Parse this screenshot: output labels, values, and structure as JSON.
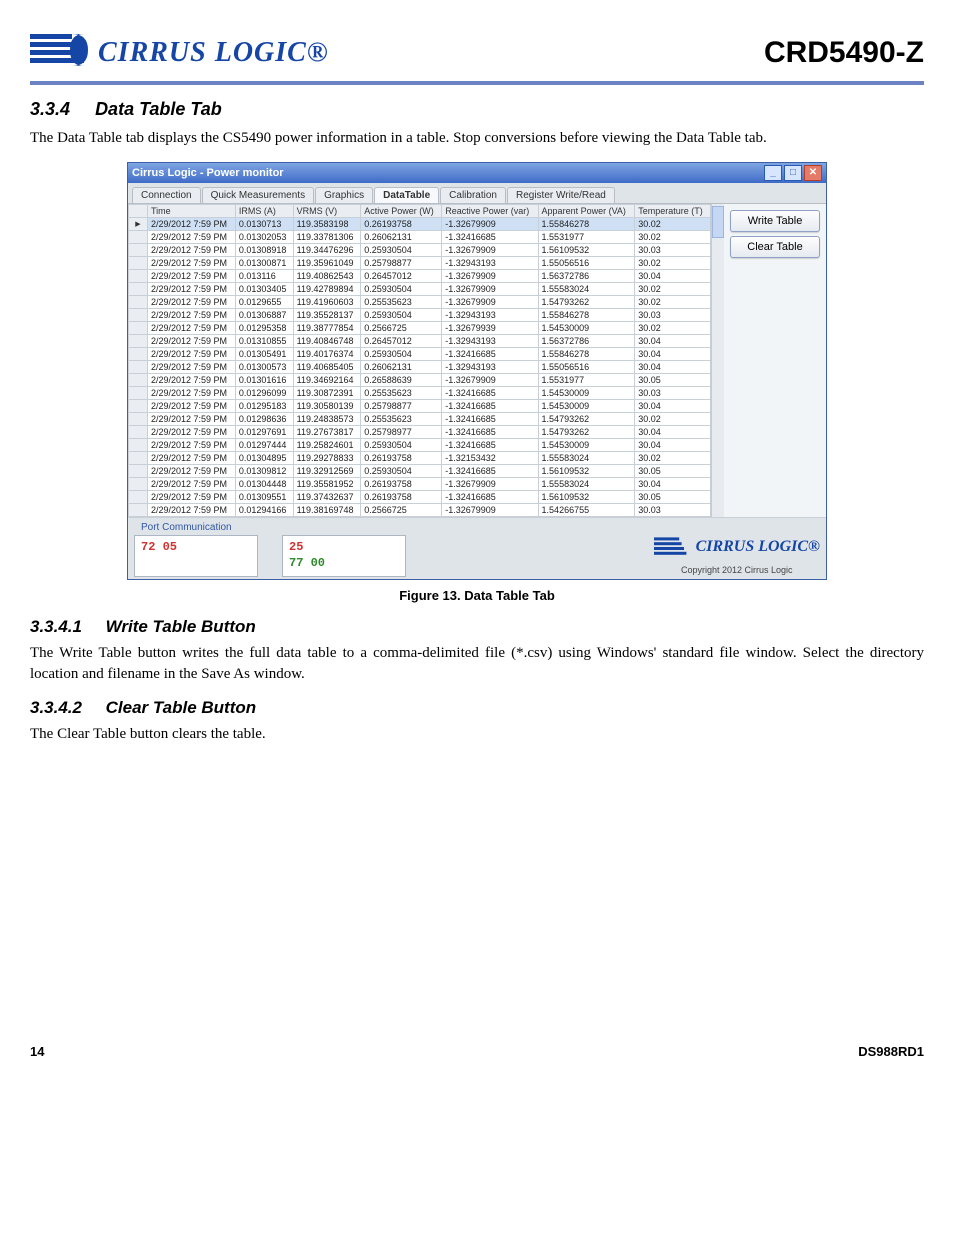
{
  "header": {
    "logo_text": "CIRRUS LOGIC®",
    "product": "CRD5490-Z"
  },
  "section_334": {
    "num": "3.3.4",
    "title": "Data Table Tab",
    "body": "The Data Table tab displays the CS5490 power information in a table. Stop conversions before viewing the Data Table tab."
  },
  "figure": {
    "caption": "Figure 13.  Data Table Tab"
  },
  "win": {
    "title": "Cirrus Logic - Power monitor",
    "tabs": [
      "Connection",
      "Quick Measurements",
      "Graphics",
      "DataTable",
      "Calibration",
      "Register Write/Read"
    ],
    "active_tab": 3,
    "buttons": {
      "write": "Write Table",
      "clear": "Clear Table"
    },
    "columns": [
      "Time",
      "IRMS (A)",
      "VRMS (V)",
      "Active Power (W)",
      "Reactive Power (var)",
      "Apparent Power (VA)",
      "Temperature (T)"
    ],
    "rows": [
      [
        "2/29/2012 7:59 PM",
        "0.0130713",
        "119.3583198",
        "0.26193758",
        "-1.32679909",
        "1.55846278",
        "30.02"
      ],
      [
        "2/29/2012 7:59 PM",
        "0.01302053",
        "119.33781306",
        "0.26062131",
        "-1.32416685",
        "1.5531977",
        "30.02"
      ],
      [
        "2/29/2012 7:59 PM",
        "0.01308918",
        "119.34476296",
        "0.25930504",
        "-1.32679909",
        "1.56109532",
        "30.03"
      ],
      [
        "2/29/2012 7:59 PM",
        "0.01300871",
        "119.35961049",
        "0.25798877",
        "-1.32943193",
        "1.55056516",
        "30.02"
      ],
      [
        "2/29/2012 7:59 PM",
        "0.013116",
        "119.40862543",
        "0.26457012",
        "-1.32679909",
        "1.56372786",
        "30.04"
      ],
      [
        "2/29/2012 7:59 PM",
        "0.01303405",
        "119.42789894",
        "0.25930504",
        "-1.32679909",
        "1.55583024",
        "30.02"
      ],
      [
        "2/29/2012 7:59 PM",
        "0.0129655",
        "119.41960603",
        "0.25535623",
        "-1.32679909",
        "1.54793262",
        "30.02"
      ],
      [
        "2/29/2012 7:59 PM",
        "0.01306887",
        "119.35528137",
        "0.25930504",
        "-1.32943193",
        "1.55846278",
        "30.03"
      ],
      [
        "2/29/2012 7:59 PM",
        "0.01295358",
        "119.38777854",
        "0.2566725",
        "-1.32679939",
        "1.54530009",
        "30.02"
      ],
      [
        "2/29/2012 7:59 PM",
        "0.01310855",
        "119.40846748",
        "0.26457012",
        "-1.32943193",
        "1.56372786",
        "30.04"
      ],
      [
        "2/29/2012 7:59 PM",
        "0.01305491",
        "119.40176374",
        "0.25930504",
        "-1.32416685",
        "1.55846278",
        "30.04"
      ],
      [
        "2/29/2012 7:59 PM",
        "0.01300573",
        "119.40685405",
        "0.26062131",
        "-1.32943193",
        "1.55056516",
        "30.04"
      ],
      [
        "2/29/2012 7:59 PM",
        "0.01301616",
        "119.34692164",
        "0.26588639",
        "-1.32679909",
        "1.5531977",
        "30.05"
      ],
      [
        "2/29/2012 7:59 PM",
        "0.01296099",
        "119.30872391",
        "0.25535623",
        "-1.32416685",
        "1.54530009",
        "30.03"
      ],
      [
        "2/29/2012 7:59 PM",
        "0.01295183",
        "119.30580139",
        "0.25798877",
        "-1.32416685",
        "1.54530009",
        "30.04"
      ],
      [
        "2/29/2012 7:59 PM",
        "0.01298636",
        "119.24838573",
        "0.25535623",
        "-1.32416685",
        "1.54793262",
        "30.02"
      ],
      [
        "2/29/2012 7:59 PM",
        "0.01297691",
        "119.27673817",
        "0.25798977",
        "-1.32416685",
        "1.54793262",
        "30.04"
      ],
      [
        "2/29/2012 7:59 PM",
        "0.01297444",
        "119.25824601",
        "0.25930504",
        "-1.32416685",
        "1.54530009",
        "30.04"
      ],
      [
        "2/29/2012 7:59 PM",
        "0.01304895",
        "119.29278833",
        "0.26193758",
        "-1.32153432",
        "1.55583024",
        "30.02"
      ],
      [
        "2/29/2012 7:59 PM",
        "0.01309812",
        "119.32912569",
        "0.25930504",
        "-1.32416685",
        "1.56109532",
        "30.05"
      ],
      [
        "2/29/2012 7:59 PM",
        "0.01304448",
        "119.35581952",
        "0.26193758",
        "-1.32679909",
        "1.55583024",
        "30.04"
      ],
      [
        "2/29/2012 7:59 PM",
        "0.01309551",
        "119.37432637",
        "0.26193758",
        "-1.32416685",
        "1.56109532",
        "30.05"
      ],
      [
        "2/29/2012 7:59 PM",
        "0.01294166",
        "119.38169748",
        "0.2566725",
        "-1.32679909",
        "1.54266755",
        "30.03"
      ]
    ],
    "port": {
      "legend": "Port Communication",
      "left_hex": "72 05",
      "right_line1": "25",
      "right_line2": "77 00",
      "footer_logo": "CIRRUS LOGIC®",
      "copyright": "Copyright 2012 Cirrus Logic"
    }
  },
  "section_3341": {
    "num": "3.3.4.1",
    "title": "Write Table Button",
    "body": "The Write Table button writes the full data table to a comma-delimited file (*.csv) using Windows' standard file window. Select the directory location and filename in the Save As window."
  },
  "section_3342": {
    "num": "3.3.4.2",
    "title": "Clear Table Button",
    "body": "The Clear Table button clears the table."
  },
  "footer": {
    "page": "14",
    "doc": "DS988RD1"
  }
}
